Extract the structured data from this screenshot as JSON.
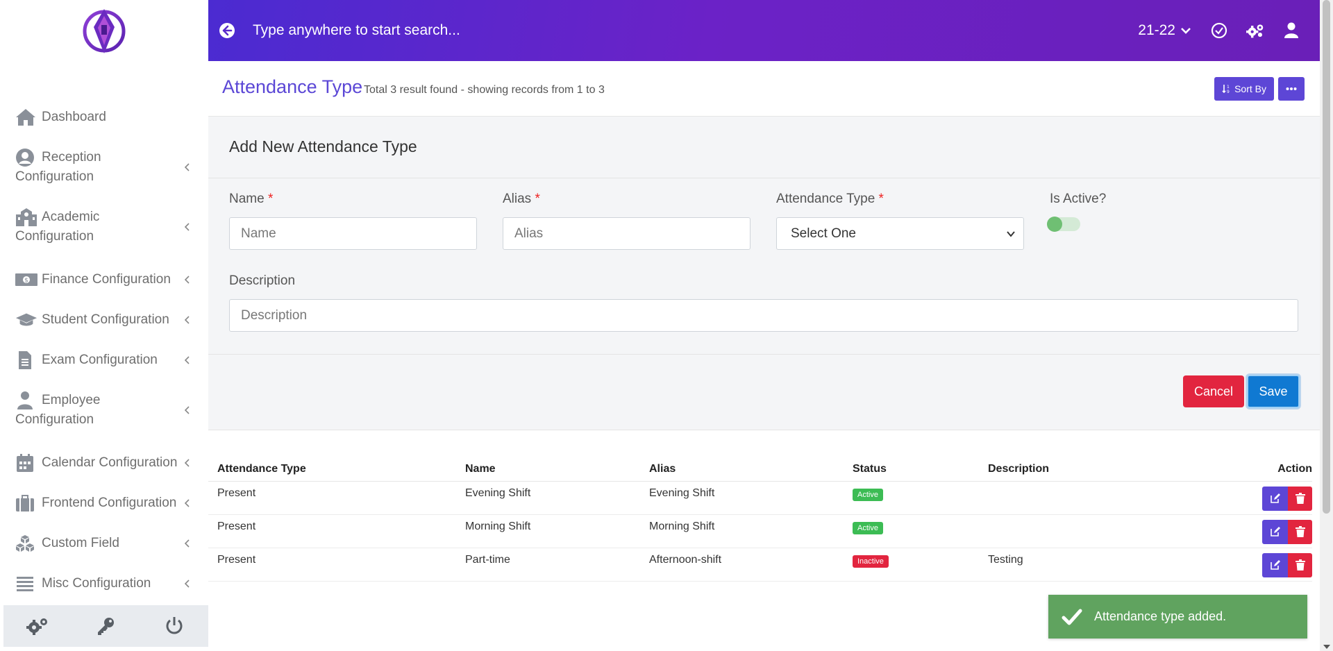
{
  "topbar": {
    "search_placeholder": "Type anywhere to start search...",
    "year": "21-22"
  },
  "sidebar": {
    "items": [
      {
        "label": "Dashboard"
      },
      {
        "label": "Reception Configuration"
      },
      {
        "label": "Academic Configuration"
      },
      {
        "label": "Finance Configuration"
      },
      {
        "label": "Student Configuration"
      },
      {
        "label": "Exam Configuration"
      },
      {
        "label": "Employee Configuration"
      },
      {
        "label": "Calendar Configuration"
      },
      {
        "label": "Frontend Configuration"
      },
      {
        "label": "Custom Field"
      },
      {
        "label": "Misc Configuration"
      }
    ],
    "reception_line1": "Reception",
    "reception_line2": "Configuration",
    "academic_line1": "Academic",
    "academic_line2": "Configuration",
    "employee_line1": "Employee",
    "employee_line2": "Configuration"
  },
  "header": {
    "title": "Attendance Type",
    "subtitle": "Total 3 result found - showing records from 1 to 3",
    "sort_label": "Sort By"
  },
  "form": {
    "title": "Add New Attendance Type",
    "name_label": "Name",
    "name_placeholder": "Name",
    "alias_label": "Alias",
    "alias_placeholder": "Alias",
    "type_label": "Attendance Type",
    "type_selected": "Select One",
    "active_label": "Is Active?",
    "description_label": "Description",
    "description_placeholder": "Description",
    "required_mark": "*",
    "cancel_label": "Cancel",
    "save_label": "Save"
  },
  "table": {
    "columns": [
      "Attendance Type",
      "Name",
      "Alias",
      "Status",
      "Description",
      "Action"
    ],
    "rows": [
      {
        "type": "Present",
        "name": "Evening Shift",
        "alias": "Evening Shift",
        "status": "Active",
        "description": ""
      },
      {
        "type": "Present",
        "name": "Morning Shift",
        "alias": "Morning Shift",
        "status": "Active",
        "description": ""
      },
      {
        "type": "Present",
        "name": "Part-time",
        "alias": "Afternoon-shift",
        "status": "Inactive",
        "description": "Testing"
      }
    ]
  },
  "toast": {
    "message": "Attendance type added."
  },
  "colors": {
    "accent": "#5d46d6",
    "danger": "#e2253f",
    "success": "#3cbc54",
    "primary": "#1079d2",
    "toast": "#60a35f"
  }
}
